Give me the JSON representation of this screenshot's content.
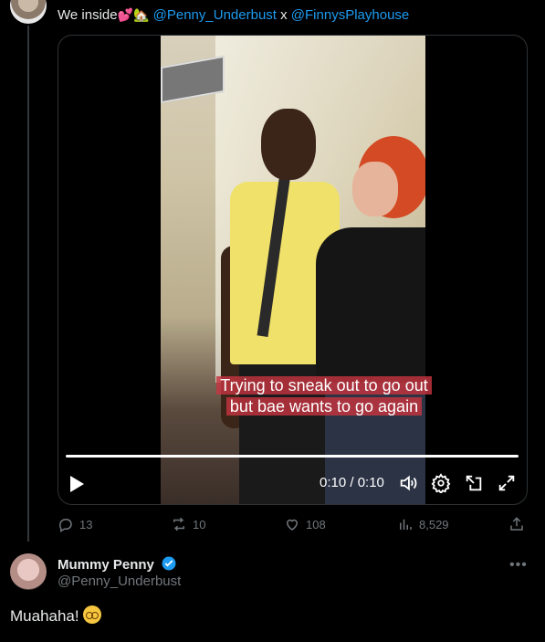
{
  "tweet": {
    "text_prefix": "We inside",
    "emoji_1": "💕",
    "emoji_2": "🏡",
    "mention_1": "@Penny_Underbust",
    "separator": "x",
    "mention_2": "@FinnysPlayhouse"
  },
  "video": {
    "caption_line_1": "Trying to sneak out to go out",
    "caption_line_2": "but bae wants to go again",
    "time": "0:10 / 0:10",
    "progress": 1.0
  },
  "actions": {
    "replies": "13",
    "reposts": "10",
    "likes": "108",
    "views": "8,529"
  },
  "reply": {
    "name": "Mummy Penny",
    "handle": "@Penny_Underbust",
    "text": "Muahaha!"
  },
  "colors": {
    "background": "#000000",
    "text": "#e7e9ea",
    "muted": "#71767b",
    "accent": "#1d9bf0",
    "caption_bg": "#c4343f"
  }
}
